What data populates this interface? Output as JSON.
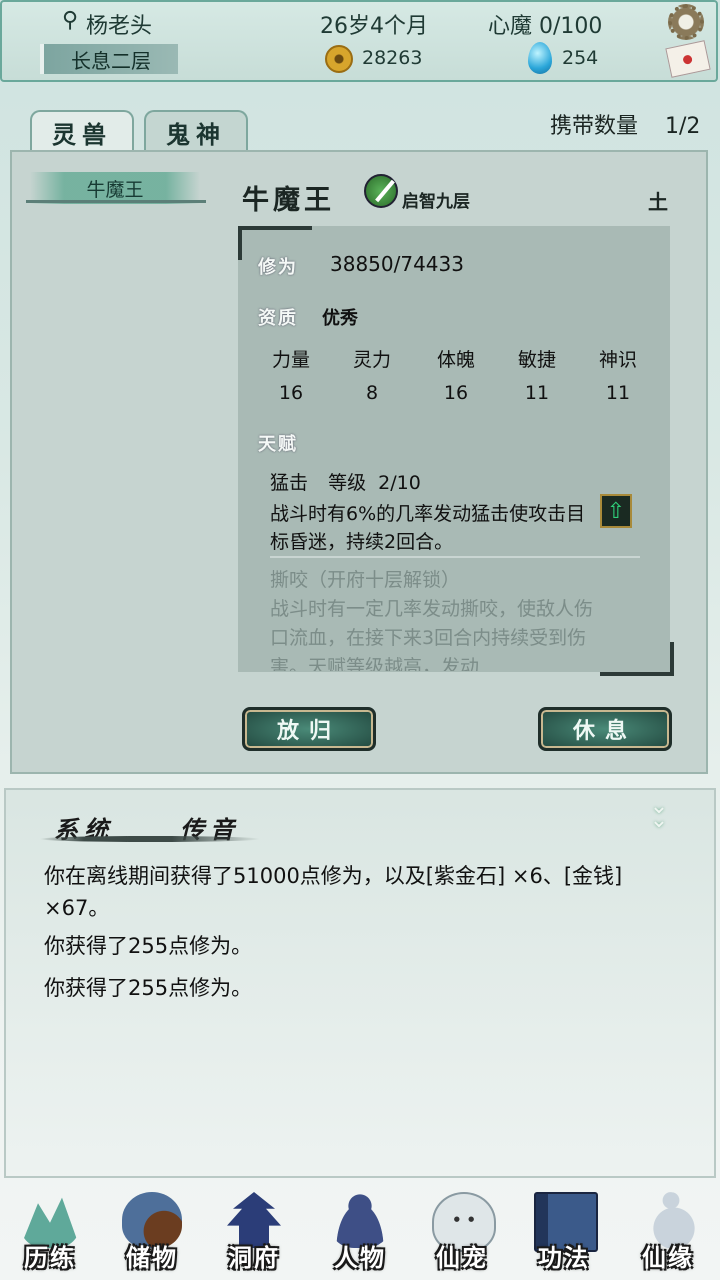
{
  "header": {
    "player_name": "杨老头",
    "age": "26岁4个月",
    "heart_demon": "心魔 0/100",
    "realm": "长息二层",
    "coins": "28263",
    "gems": "254"
  },
  "tabs": [
    {
      "label": "灵兽"
    },
    {
      "label": "鬼神"
    }
  ],
  "carry_label": "携带数量",
  "carry_count": "1/2",
  "pet_list": [
    {
      "name": "牛魔王"
    }
  ],
  "pet": {
    "name": "牛魔王",
    "stage": "启智九层",
    "element": "土",
    "cultivation_label": "修为",
    "cultivation_value": "38850/74433",
    "aptitude_label": "资质",
    "aptitude_value": "优秀",
    "stats": [
      {
        "name": "力量",
        "value": "16"
      },
      {
        "name": "灵力",
        "value": "8"
      },
      {
        "name": "体魄",
        "value": "16"
      },
      {
        "name": "敏捷",
        "value": "11"
      },
      {
        "name": "神识",
        "value": "11"
      }
    ],
    "talent_label": "天赋",
    "talents": [
      {
        "name": "猛击",
        "level_label": "等级",
        "level": "2/10",
        "desc": "战斗时有6%的几率发动猛击使攻击目标昏迷，持续2回合。"
      },
      {
        "name": "撕咬（开府十层解锁）",
        "desc": "战斗时有一定几率发动撕咬，使敌人伤口流血，在接下来3回合内持续受到伤害。天赋等级越高，发动"
      }
    ]
  },
  "buttons": {
    "release": "放归",
    "rest": "休息"
  },
  "chat": {
    "tabs": [
      "系统",
      "传音"
    ],
    "messages": [
      "你在离线期间获得了51000点修为，以及[紫金石] ×6、[金钱] ×67。",
      "你获得了255点修为。",
      "你获得了255点修为。"
    ]
  },
  "nav": [
    {
      "label": "历练",
      "icon": "mountain-icon",
      "color": "#5fa99a"
    },
    {
      "label": "储物",
      "icon": "bag-icon",
      "color": "#4e6f9a"
    },
    {
      "label": "洞府",
      "icon": "pagoda-icon",
      "color": "#2b3d78"
    },
    {
      "label": "人物",
      "icon": "person-icon",
      "color": "#3e4f86"
    },
    {
      "label": "仙宠",
      "icon": "ghost-pet-icon",
      "color": "#dfe6e8"
    },
    {
      "label": "功法",
      "icon": "book-icon",
      "color": "#3b5a8a"
    },
    {
      "label": "仙缘",
      "icon": "crane-icon",
      "color": "#c9d3dc"
    }
  ]
}
